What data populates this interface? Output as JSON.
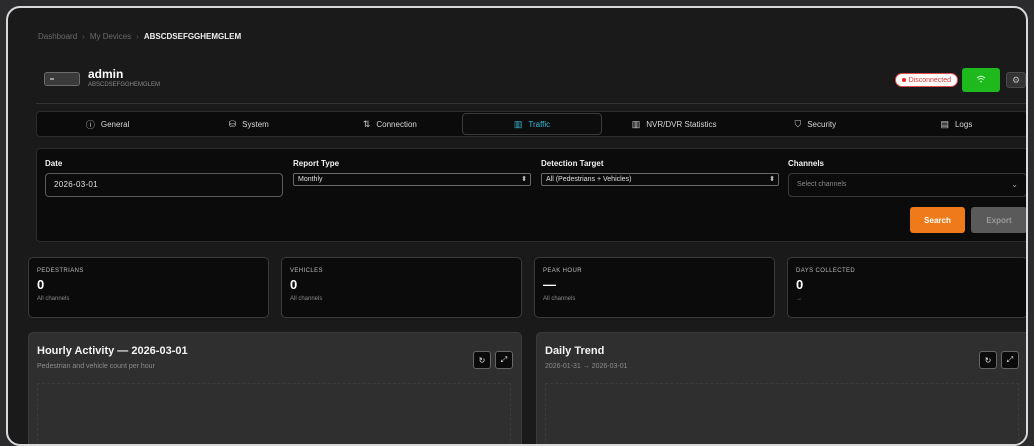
{
  "breadcrumb": {
    "items": [
      "Dashboard",
      "My Devices"
    ],
    "current": "ABSCDSEFGGHEMGLEM",
    "separator": "›"
  },
  "device": {
    "name": "admin",
    "id": "ABSCDSEFGGHEMGLEM",
    "status": "Disconnected",
    "status_color": "#e22222",
    "wifi_color": "#1db91d",
    "wifi_icon": "wifi-icon",
    "settings_icon": "gear-icon"
  },
  "tabs": [
    {
      "label": "General",
      "icon": "info-icon",
      "glyph": "ⓘ",
      "active": false
    },
    {
      "label": "System",
      "icon": "drive-icon",
      "glyph": "⛁",
      "active": false
    },
    {
      "label": "Connection",
      "icon": "connection-icon",
      "glyph": "⇅",
      "active": false
    },
    {
      "label": "Traffic",
      "icon": "bar-chart-icon",
      "glyph": "▥",
      "active": true
    },
    {
      "label": "NVR/DVR Statistics",
      "icon": "bar-chart-icon",
      "glyph": "▥",
      "active": false
    },
    {
      "label": "Security",
      "icon": "shield-icon",
      "glyph": "⛉",
      "active": false
    },
    {
      "label": "Logs",
      "icon": "document-icon",
      "glyph": "▤",
      "active": false
    }
  ],
  "filters": {
    "date_label": "Date",
    "date_value": "2026-03-01",
    "report_type_label": "Report Type",
    "report_type_value": "Monthly",
    "detection_label": "Detection Target",
    "detection_value": "All (Pedestrians + Vehicles)",
    "channels_label": "Channels",
    "channels_placeholder": "Select channels",
    "search_label": "Search",
    "export_label": "Export",
    "accent": "#ee7a1a"
  },
  "stats": [
    {
      "label": "PEDESTRIANS",
      "value": "0",
      "sub": "All channels"
    },
    {
      "label": "VEHICLES",
      "value": "0",
      "sub": "All channels"
    },
    {
      "label": "PEAK HOUR",
      "value": "—",
      "sub": "All channels"
    },
    {
      "label": "DAYS COLLECTED",
      "value": "0",
      "sub": "→"
    }
  ],
  "charts": {
    "hourly": {
      "title": "Hourly Activity — 2026-03-01",
      "subtitle": "Pedestrian and vehicle count per hour"
    },
    "daily": {
      "title": "Daily Trend",
      "subtitle": "2026-01-31 → 2026-03-01"
    }
  }
}
